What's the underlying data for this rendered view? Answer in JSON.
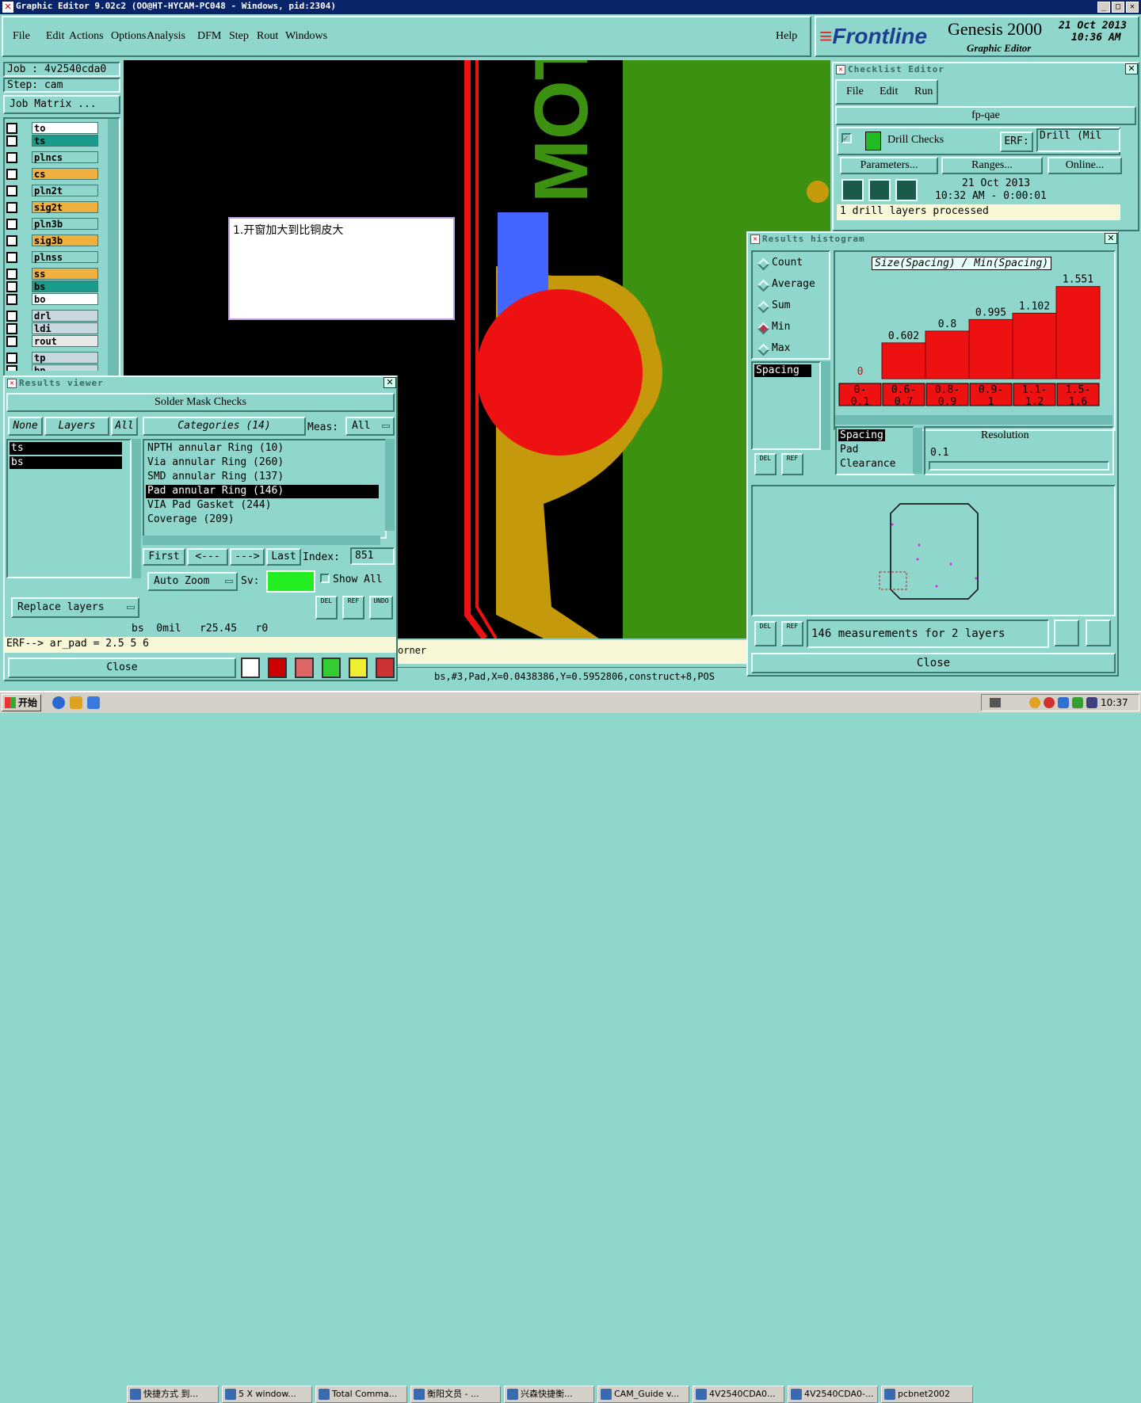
{
  "window": {
    "title": "Graphic Editor 9.02c2 (OO@HT-HYCAM-PC048 - Windows, pid:2304)"
  },
  "menubar": {
    "items": [
      "File",
      "Edit",
      "Actions",
      "Options",
      "Analysis",
      "DFM",
      "Step",
      "Rout",
      "Windows"
    ],
    "help": "Help"
  },
  "brand": {
    "logo": "Frontline",
    "product": "Genesis 2000",
    "subtitle": "Graphic Editor",
    "date": "21 Oct 2013",
    "time": "10:36 AM"
  },
  "job": {
    "job_label": "Job : 4v2540cda0",
    "step_label": "Step: cam",
    "matrix_button": "Job Matrix ..."
  },
  "layers": [
    {
      "name": "to",
      "color": "#ffffff"
    },
    {
      "name": "ts",
      "color": "#1a9c8c"
    },
    {
      "name": "plncs",
      "color": "#8fd6cc"
    },
    {
      "name": "cs",
      "color": "#f0b040"
    },
    {
      "name": "pln2t",
      "color": "#8fd6cc"
    },
    {
      "name": "sig2t",
      "color": "#f0b040"
    },
    {
      "name": "pln3b",
      "color": "#8fd6cc"
    },
    {
      "name": "sig3b",
      "color": "#f0b040"
    },
    {
      "name": "plnss",
      "color": "#8fd6cc"
    },
    {
      "name": "ss",
      "color": "#f0b040"
    },
    {
      "name": "bs",
      "color": "#1a9c8c"
    },
    {
      "name": "bo",
      "color": "#ffffff"
    },
    {
      "name": "drl",
      "color": "#c8d8e0"
    },
    {
      "name": "ldi",
      "color": "#c8d8e0"
    },
    {
      "name": "rout",
      "color": "#e8e8e8"
    },
    {
      "name": "tp",
      "color": "#c8d8e0"
    },
    {
      "name": "bp",
      "color": "#c8d8e0"
    }
  ],
  "canvas": {
    "board_text": "MOT",
    "note": "1.开窗加大到比铜皮大",
    "status_right": "orner",
    "coords": "bs,#3,Pad,X=0.0438386,Y=0.5952806,construct+8,POS"
  },
  "results_viewer": {
    "title": "Results viewer",
    "header": "Solder Mask Checks",
    "none_btn": "None",
    "layers_btn": "Layers",
    "all_btn": "All",
    "layer_list": [
      "ts",
      "bs"
    ],
    "categories_label": "Categories (14)",
    "meas_label": "Meas:",
    "meas_value": "All",
    "categories": [
      "NPTH annular Ring (10)",
      "Via annular Ring (260)",
      "SMD annular Ring (137)",
      "Pad annular Ring (146)",
      "VIA Pad Gasket (244)",
      "Coverage (209)"
    ],
    "selected_category": 3,
    "nav": {
      "first": "First",
      "prev": "<---",
      "next": "--->",
      "last": "Last",
      "index_label": "Index:",
      "index_value": "851"
    },
    "auto_zoom": "Auto Zoom",
    "sv_label": "Sv:",
    "show_all": "Show All",
    "replace_layers": "Replace layers",
    "small_btns": [
      "DEL",
      "REF",
      "UNDO"
    ],
    "info_line": "bs  0mil   r25.45   r0",
    "erf_line": "ERF--> ar_pad = 2.5 5 6",
    "close": "Close"
  },
  "checklist": {
    "title": "Checklist Editor",
    "menu": [
      "File",
      "Edit",
      "Run"
    ],
    "name": "fp-qae",
    "check_name": "Drill Checks",
    "erf_label": "ERF:",
    "erf_value": "Drill (Mil",
    "buttons": [
      "Parameters...",
      "Ranges...",
      "Online..."
    ],
    "date": "21 Oct 2013",
    "time_line": "10:32 AM - 0:00:01",
    "status": "1 drill layers processed"
  },
  "histogram": {
    "title": "Results histogram",
    "modes": [
      "Count",
      "Average",
      "Sum",
      "Min",
      "Max"
    ],
    "selected_mode": "Min",
    "measure_list": [
      "Spacing"
    ],
    "chart_title": "Size(Spacing) / Min(Spacing)",
    "resolution_label": "Resolution",
    "resolution_value": "0.1",
    "side_list": [
      "Spacing",
      "Pad",
      "Clearance"
    ],
    "measurements": "146 measurements for 2 layers",
    "small_btns": [
      "DEL",
      "REF"
    ],
    "close": "Close"
  },
  "chart_data": {
    "type": "bar",
    "title": "Size(Spacing) / Min(Spacing)",
    "categories": [
      "0-0.1",
      "0.6-0.7",
      "0.8-0.9",
      "0.9-1",
      "1.1-1.2",
      "1.5-1.6"
    ],
    "values": [
      0,
      0.602,
      0.8,
      0.995,
      1.102,
      1.551
    ],
    "labels": [
      "0",
      "0.602",
      "0.8",
      "0.995",
      "1.102",
      "1.551"
    ],
    "ylim": [
      0,
      1.6
    ],
    "bar_color": "#ee1111"
  },
  "taskbar": {
    "start": "开始",
    "items": [
      "快捷方式 到...",
      "5 X window...",
      "Total Comma...",
      "衡阳文员 - ...",
      "兴森快捷衡...",
      "CAM_Guide v...",
      "4V2540CDA0...",
      "4V2540CDA0-...",
      "pcbnet2002"
    ],
    "clock": "10:37"
  }
}
